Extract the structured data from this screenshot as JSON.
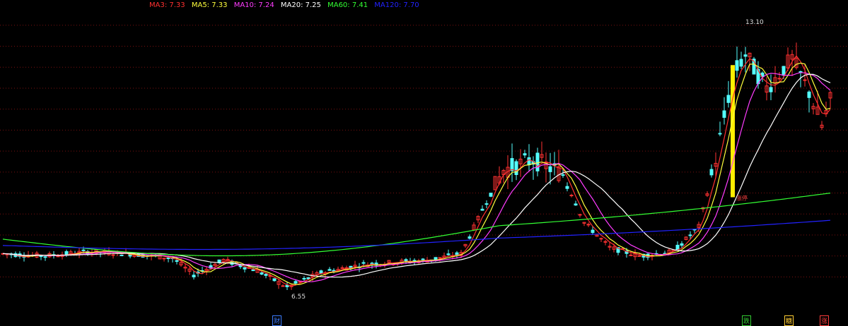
{
  "chart_data": {
    "type": "candlestick",
    "legend": [
      {
        "label": "MA3: 7.33",
        "color": "#ff3030"
      },
      {
        "label": "MA5: 7.33",
        "color": "#ffff3c"
      },
      {
        "label": "MA10: 7.24",
        "color": "#ff3cff"
      },
      {
        "label": "MA20: 7.25",
        "color": "#ffffff"
      },
      {
        "label": "MA60: 7.41",
        "color": "#33ff33"
      },
      {
        "label": "MA120: 7.70",
        "color": "#2222ff"
      }
    ],
    "annotations": {
      "high_label": "13.10",
      "high_value": 13.1,
      "low_label": "6.55",
      "low_value": 6.55,
      "signal_label": "涨停"
    },
    "bottom_markers": [
      {
        "label": "财",
        "color": "#3c7cff"
      },
      {
        "label": "跌",
        "color": "#33cc33"
      },
      {
        "label": "糖",
        "color": "#ffcc33"
      },
      {
        "label": "涨",
        "color": "#ff3c3c"
      }
    ],
    "ylim": [
      6.2,
      13.4
    ],
    "gridlines": [
      7.0,
      7.5,
      8.0,
      8.5,
      9.0,
      9.5,
      10.0,
      10.5,
      11.0,
      11.5,
      12.0,
      12.5,
      13.0
    ],
    "ma60_start": 7.9,
    "ma60_end": 9.0,
    "ma120_start": 7.75,
    "ma120_end": 8.35
  }
}
